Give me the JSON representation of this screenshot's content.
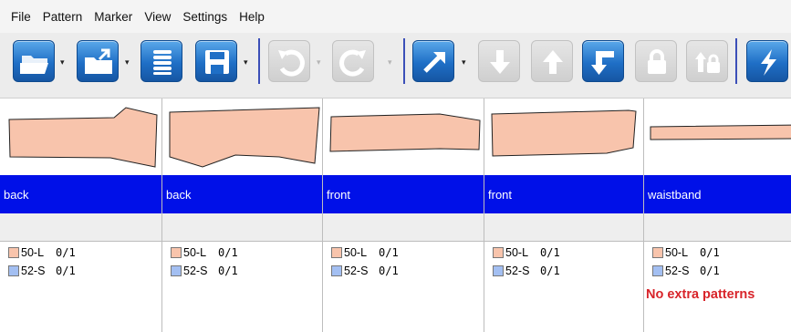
{
  "menu": [
    "File",
    "Pattern",
    "Marker",
    "View",
    "Settings",
    "Help"
  ],
  "toolbar": {
    "buttons": [
      {
        "icon": "open-folder-icon",
        "state": "enabled",
        "dropdown": true
      },
      {
        "icon": "folder-upload-icon",
        "state": "enabled",
        "dropdown": true
      },
      {
        "icon": "list-icon",
        "state": "enabled",
        "dropdown": false
      },
      {
        "icon": "save-icon",
        "state": "enabled",
        "dropdown": true
      },
      {
        "icon": "undo-icon",
        "state": "disabled",
        "dropdown": true
      },
      {
        "icon": "redo-icon",
        "state": "disabled",
        "dropdown": true
      },
      {
        "icon": "diagonal-arrow-icon",
        "state": "enabled",
        "dropdown": true
      },
      {
        "icon": "arrow-down-icon",
        "state": "disabled",
        "dropdown": false
      },
      {
        "icon": "arrow-up-icon",
        "state": "disabled",
        "dropdown": false
      },
      {
        "icon": "down-right-arrow-icon",
        "state": "enabled",
        "dropdown": false
      },
      {
        "icon": "lock-icon",
        "state": "disabled",
        "dropdown": false
      },
      {
        "icon": "up-lock-icon",
        "state": "disabled",
        "dropdown": false
      },
      {
        "icon": "lightning-icon",
        "state": "enabled",
        "dropdown": false
      }
    ]
  },
  "patterns": [
    {
      "name": "back",
      "sizes": [
        {
          "label": "50-L",
          "count": "0/1"
        },
        {
          "label": "52-S",
          "count": "0/1"
        }
      ]
    },
    {
      "name": "back",
      "sizes": [
        {
          "label": "50-L",
          "count": "0/1"
        },
        {
          "label": "52-S",
          "count": "0/1"
        }
      ]
    },
    {
      "name": "front",
      "sizes": [
        {
          "label": "50-L",
          "count": "0/1"
        },
        {
          "label": "52-S",
          "count": "0/1"
        }
      ]
    },
    {
      "name": "front",
      "sizes": [
        {
          "label": "50-L",
          "count": "0/1"
        },
        {
          "label": "52-S",
          "count": "0/1"
        }
      ]
    },
    {
      "name": "waistband",
      "sizes": [
        {
          "label": "50-L",
          "count": "0/1"
        },
        {
          "label": "52-S",
          "count": "0/1"
        }
      ],
      "note": "No extra patterns"
    }
  ],
  "colors": {
    "title_bar": "#0010e8",
    "piece_fill": "#f8c4ac",
    "size_l_swatch": "#f8c4ac",
    "size_s_swatch": "#a3bff2",
    "note_text": "#d8242a"
  }
}
